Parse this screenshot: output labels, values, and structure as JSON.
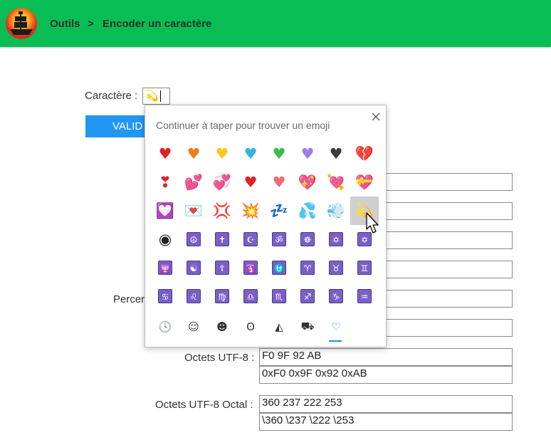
{
  "header": {
    "crumb_root": "Outils",
    "crumb_sep": ">",
    "crumb_page": "Encoder un caractère"
  },
  "form": {
    "char_label": "Caractère :",
    "char_value": "💫",
    "validate_label": "VALID",
    "percent_label": "Percer",
    "utf8_label": "Octets UTF-8 :",
    "utf8_hex": "F0 9F 92 AB",
    "utf8_hex_prefixed": "0xF0 0x9F 0x92 0xAB",
    "utf8_octal_label": "Octets UTF-8 Octal :",
    "utf8_octal": "360 237 222 253",
    "utf8_octal_escaped": "\\360 \\237 \\222 \\253"
  },
  "emoji_panel": {
    "prompt": "Continuer à taper pour trouver un emoji",
    "rows": [
      [
        {
          "g": "♥",
          "c": "#e0202a"
        },
        {
          "g": "♥",
          "c": "#f27b1a"
        },
        {
          "g": "♥",
          "c": "#ffc61a"
        },
        {
          "g": "♥",
          "c": "#2fb5e8"
        },
        {
          "g": "♥",
          "c": "#37c04a"
        },
        {
          "g": "♥",
          "c": "#9b7fe6"
        },
        {
          "g": "♥",
          "c": "#3c3c3c"
        },
        {
          "g": "💔",
          "c": "#e0202a"
        }
      ],
      [
        {
          "g": "❣",
          "c": "#e0202a"
        },
        {
          "g": "💕",
          "c": "#e0202a"
        },
        {
          "g": "💞",
          "c": "#e0202a"
        },
        {
          "g": "♥",
          "c": "#e0202a"
        },
        {
          "g": "♥",
          "c": "#f06a7a"
        },
        {
          "g": "💖",
          "c": "#e0202a"
        },
        {
          "g": "💘",
          "c": "#e0202a"
        },
        {
          "g": "💝",
          "c": "#e0202a"
        }
      ],
      [
        {
          "g": "💟",
          "c": "#e0202a"
        },
        {
          "g": "💌",
          "c": "#e0202a"
        },
        {
          "g": "💢",
          "c": "#e0202a"
        },
        {
          "g": "💥",
          "c": "#e0202a"
        },
        {
          "g": "💤",
          "c": "#1a7fd1"
        },
        {
          "g": "💦",
          "c": "#2fb5e8"
        },
        {
          "g": "💨",
          "c": "#555555"
        },
        {
          "g": "💫",
          "c": "#e8b817"
        }
      ],
      [
        {
          "g": "◉",
          "c": "#222222"
        },
        {
          "g": "☮",
          "c": "sym"
        },
        {
          "g": "✝",
          "c": "sym"
        },
        {
          "g": "☪",
          "c": "sym"
        },
        {
          "g": "ॐ",
          "c": "sym"
        },
        {
          "g": "☸",
          "c": "sym"
        },
        {
          "g": "✡",
          "c": "sym"
        },
        {
          "g": "✡",
          "c": "sym"
        }
      ],
      [
        {
          "g": "🕎",
          "c": "sym"
        },
        {
          "g": "☯",
          "c": "sym"
        },
        {
          "g": "☦",
          "c": "sym"
        },
        {
          "g": "🛐",
          "c": "sym"
        },
        {
          "g": "⛎",
          "c": "sym"
        },
        {
          "g": "♈",
          "c": "sym"
        },
        {
          "g": "♉",
          "c": "sym"
        },
        {
          "g": "♊",
          "c": "sym"
        }
      ],
      [
        {
          "g": "♋",
          "c": "sym"
        },
        {
          "g": "♌",
          "c": "sym"
        },
        {
          "g": "♍",
          "c": "sym"
        },
        {
          "g": "♎",
          "c": "sym"
        },
        {
          "g": "♏",
          "c": "sym"
        },
        {
          "g": "♐",
          "c": "sym"
        },
        {
          "g": "♑",
          "c": "sym"
        },
        {
          "g": "♒",
          "c": "sym"
        }
      ]
    ],
    "selected": {
      "row": 2,
      "col": 7
    },
    "tabs": [
      {
        "name": "recent-tab",
        "icon": "clock-icon",
        "g": "🕓"
      },
      {
        "name": "smileys-tab",
        "icon": "smiley-icon",
        "g": "☺"
      },
      {
        "name": "people-tab",
        "icon": "person-icon",
        "g": "☻"
      },
      {
        "name": "celebration-tab",
        "icon": "balloon-icon",
        "g": "ʘ"
      },
      {
        "name": "food-tab",
        "icon": "pizza-icon",
        "g": "◭"
      },
      {
        "name": "travel-tab",
        "icon": "car-icon",
        "g": "⛟"
      },
      {
        "name": "symbols-tab",
        "icon": "heart-outline-icon",
        "g": "♡"
      }
    ],
    "active_tab": 6
  }
}
